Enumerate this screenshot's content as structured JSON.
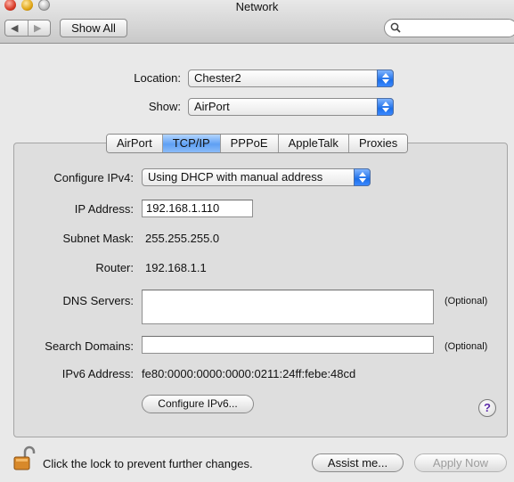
{
  "window": {
    "title": "Network"
  },
  "toolbar": {
    "back": "◀",
    "forward": "▶",
    "show_all": "Show All",
    "search_placeholder": ""
  },
  "location": {
    "label": "Location:",
    "value": "Chester2"
  },
  "show": {
    "label": "Show:",
    "value": "AirPort"
  },
  "tabs": [
    {
      "label": "AirPort",
      "active": false
    },
    {
      "label": "TCP/IP",
      "active": true
    },
    {
      "label": "PPPoE",
      "active": false
    },
    {
      "label": "AppleTalk",
      "active": false
    },
    {
      "label": "Proxies",
      "active": false
    }
  ],
  "tcpip": {
    "configure_ipv4_label": "Configure IPv4:",
    "configure_ipv4_value": "Using DHCP with manual address",
    "ip_label": "IP Address:",
    "ip_value": "192.168.1.110",
    "subnet_label": "Subnet Mask:",
    "subnet_value": "255.255.255.0",
    "router_label": "Router:",
    "router_value": "192.168.1.1",
    "dns_label": "DNS Servers:",
    "dns_value": "",
    "dns_optional": "(Optional)",
    "search_label": "Search Domains:",
    "search_value": "",
    "search_optional": "(Optional)",
    "ipv6_label": "IPv6 Address:",
    "ipv6_value": "fe80:0000:0000:0000:0211:24ff:febe:48cd",
    "configure_ipv6": "Configure IPv6..."
  },
  "footer": {
    "lock_text": "Click the lock to prevent further changes.",
    "assist": "Assist me...",
    "apply": "Apply Now",
    "help": "?"
  }
}
